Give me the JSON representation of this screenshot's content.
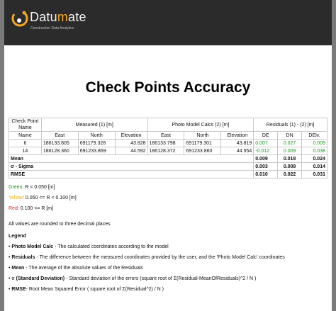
{
  "brand": {
    "name_main": "Datu",
    "name_accent": "m",
    "name_rest": "ate",
    "tagline": "Construction Data Analytics"
  },
  "report": {
    "title": "Check Points Accuracy"
  },
  "table": {
    "group_headers": {
      "checkpoint": "Check Point Name",
      "measured": "Measured (1) [m]",
      "calcs": "Photo Model Calcs (2) [m]",
      "residuals": "Residuals (1) - (2) [m]"
    },
    "sub_headers": {
      "name": "Name",
      "m_east": "East",
      "m_north": "North",
      "m_elev": "Elevation",
      "c_east": "East",
      "c_north": "North",
      "c_elev": "Elevation",
      "de": "DE",
      "dn": "DN",
      "delv": "DElv."
    },
    "rows": [
      {
        "name": "6",
        "m_east": "186133.805",
        "m_north": "691179.328",
        "m_elev": "43.828",
        "c_east": "186133.798",
        "c_north": "691179.301",
        "c_elev": "43.819",
        "de": "0.007",
        "dn": "0.027",
        "delv": "0.009"
      },
      {
        "name": "14",
        "m_east": "186128.360",
        "m_north": "691233.869",
        "m_elev": "44.592",
        "c_east": "186128.372",
        "c_north": "691233.860",
        "c_elev": "44.554",
        "de": "-0.012",
        "dn": "0.009",
        "delv": "0.038"
      }
    ],
    "stats": [
      {
        "label": "Mean",
        "de": "0.009",
        "dn": "0.018",
        "delv": "0.024"
      },
      {
        "label": "σ - Sigma",
        "de": "0.003",
        "dn": "0.009",
        "delv": "0.014"
      },
      {
        "label": "RMSE",
        "de": "0.010",
        "dn": "0.022",
        "delv": "0.031"
      }
    ]
  },
  "thresholds": {
    "green_word": "Green",
    "green_rule": ": R < 0.050 [m]",
    "yellow_word": "Yellow",
    "yellow_rule": ": 0.050 <= R < 0.100 [m]",
    "red_word": "Red",
    "red_rule": ": 0.100 <= R [m]"
  },
  "note": "All values are rounded to three decimal places",
  "legend": {
    "heading": "Legend",
    "items": [
      {
        "term": "Photo Model Calc",
        "desc": " - The calculated coordinates according to the model"
      },
      {
        "term": "Residuals",
        "desc": " - The difference between the measured coordinates provided by the user, and the 'Photo Model Calc' coordinates"
      },
      {
        "term": "Mean",
        "desc": " - The average of the absolute values of the Residuals"
      },
      {
        "prefix": "σ ",
        "term": "(Standard Deviation)",
        "desc": " - Standard deviation of the errors (square root of Σ(Residual-MeanOfResiduals)^2 / N )"
      },
      {
        "term": "RMSE",
        "desc": "- Root Mean Squared Error ( square root of Σ(Residual^2) / N )"
      }
    ]
  },
  "colors": {
    "header_bg": "#2b2b2b",
    "accent": "#f5a623",
    "green": "#1a9a1a",
    "yellow": "#e6b800",
    "red": "#e02020"
  }
}
